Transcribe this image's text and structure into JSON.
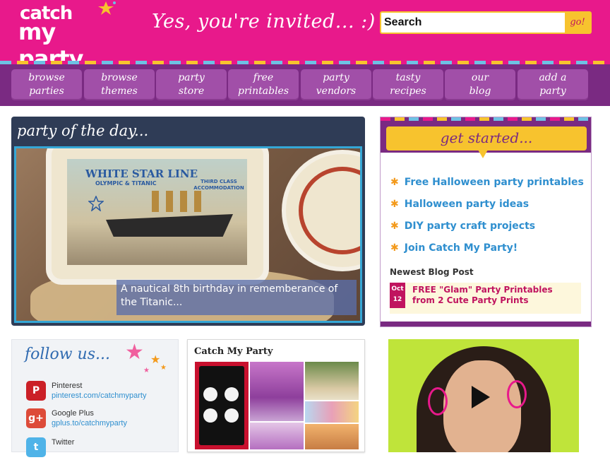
{
  "header": {
    "logo_line1": "catch",
    "logo_line2": "my party",
    "tagline": "Yes, you're invited... :)",
    "search_value": "Search",
    "search_button": "go!"
  },
  "nav": [
    {
      "line1": "browse",
      "line2": "parties"
    },
    {
      "line1": "browse",
      "line2": "themes"
    },
    {
      "line1": "party",
      "line2": "store"
    },
    {
      "line1": "free",
      "line2": "printables"
    },
    {
      "line1": "party",
      "line2": "vendors"
    },
    {
      "line1": "tasty",
      "line2": "recipes"
    },
    {
      "line1": "our",
      "line2": "blog"
    },
    {
      "line1": "add a",
      "line2": "party"
    }
  ],
  "party_of_the_day": {
    "title": "party of the day...",
    "caption": "A nautical 8th birthday in rememberance of the Titanic...",
    "cookie_text": {
      "white_star_line": "WHITE STAR LINE",
      "olympic_titanic": "OLYMPIC & TITANIC",
      "third_class": "THIRD CLASS ACCOMMODATION"
    }
  },
  "get_started": {
    "title": "get started...",
    "links": [
      "Free Halloween party printables",
      "Halloween party ideas",
      "DIY party craft projects",
      "Join Catch My Party!"
    ],
    "newest_label": "Newest Blog Post",
    "post": {
      "month": "Oct",
      "day": "12",
      "title": "FREE \"Glam\" Party Printables from 2 Cute Party Prints"
    }
  },
  "follow": {
    "title": "follow us...",
    "items": [
      {
        "name": "Pinterest",
        "url": "pinterest.com/catchmyparty",
        "icon": "pinterest-icon",
        "glyph": "P",
        "color": "#cb2027"
      },
      {
        "name": "Google Plus",
        "url": "gplus.to/catchmyparty",
        "icon": "google-plus-icon",
        "glyph": "g+",
        "color": "#dd4b39"
      },
      {
        "name": "Twitter",
        "url": "",
        "icon": "twitter-icon",
        "glyph": "t",
        "color": "#4fb3e8"
      }
    ]
  },
  "widget": {
    "title": "Catch My Party"
  },
  "colors": {
    "brand_pink": "#e8198b",
    "brand_purple": "#7a2a82",
    "accent_yellow": "#f7c32e",
    "link_blue": "#2f8fcf"
  }
}
